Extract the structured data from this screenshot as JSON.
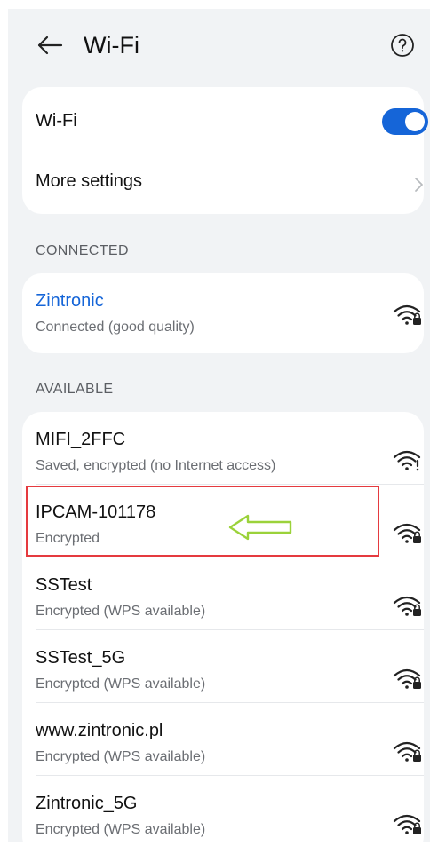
{
  "header": {
    "title": "Wi-Fi",
    "back_icon": "arrow-left-icon",
    "help_icon": "help-circle-icon"
  },
  "settings": {
    "wifi_label": "Wi-Fi",
    "wifi_enabled": true,
    "more_settings_label": "More settings"
  },
  "connected": {
    "section_label": "CONNECTED",
    "network": {
      "name": "Zintronic",
      "status": "Connected (good quality)",
      "icon": "wifi-locked-icon"
    }
  },
  "available": {
    "section_label": "AVAILABLE",
    "networks": [
      {
        "name": "MIFI_2FFC",
        "status": "Saved, encrypted (no Internet access)",
        "icon": "wifi-no-internet-icon"
      },
      {
        "name": "IPCAM-101178",
        "status": "Encrypted",
        "icon": "wifi-locked-icon"
      },
      {
        "name": "SSTest",
        "status": "Encrypted (WPS available)",
        "icon": "wifi-locked-icon"
      },
      {
        "name": "SSTest_5G",
        "status": "Encrypted (WPS available)",
        "icon": "wifi-locked-icon"
      },
      {
        "name": "www.zintronic.pl",
        "status": "Encrypted (WPS available)",
        "icon": "wifi-locked-icon"
      },
      {
        "name": "Zintronic_5G",
        "status": "Encrypted (WPS available)",
        "icon": "wifi-locked-icon"
      }
    ]
  },
  "colors": {
    "accent": "#1565d8",
    "annotation_box": "#e53a3f",
    "annotation_arrow": "#9bd23a"
  }
}
